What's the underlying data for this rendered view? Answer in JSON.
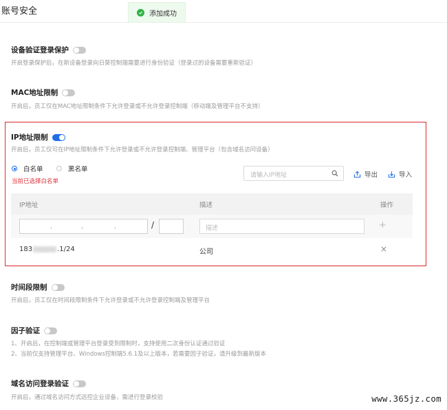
{
  "page": {
    "title": "账号安全"
  },
  "toast": {
    "text": "添加成功"
  },
  "sections": [
    {
      "title": "设备验证登录保护",
      "enabled": false,
      "desc": "开启登录保护后，在新设备登录向日葵控制端需要进行身份验证（登录过的设备需要重新验证）"
    },
    {
      "title": "MAC地址限制",
      "enabled": false,
      "desc": "开启后，员工仅在MAC地址限制条件下允许登录或不允许登录控制端（移动端及管理平台不支持）"
    },
    {
      "title": "IP地址限制",
      "enabled": true,
      "desc": "开启后，员工仅可在IP地址限制条件下允许登录或不允许登录控制端、管理平台（包含域名访问设备）"
    },
    {
      "title": "时间段限制",
      "enabled": false,
      "desc": "开启后，员工仅在时间段限制条件下允许登录或不允许登录控制端及管理平台"
    },
    {
      "title": "因子验证",
      "enabled": false,
      "desc_lines": [
        "1、开启后，在控制端或管理平台登录受到限制时，支持使用二次身份认证通过验证",
        "2、当前仅支持管理平台、Windows控制端5.6.1及以上版本，若需要因子验证，请升级到最新版本"
      ]
    },
    {
      "title": "域名访问登录验证",
      "enabled": false,
      "desc": "开启后，通过域名访问方式远控企业设备，需进行登录校验"
    }
  ],
  "ip": {
    "whitelist": "白名单",
    "blacklist": "黑名单",
    "selected": "whitelist",
    "hint": "当前已选择白名单",
    "search_placeholder": "请输入IP地址",
    "export": "导出",
    "import": "导入",
    "table": {
      "headers": {
        "ip": "IP地址",
        "desc": "描述",
        "action": "操作"
      },
      "input": {
        "dots": [
          ".",
          ".",
          "."
        ],
        "slash": "/",
        "desc_placeholder": "描述",
        "add": "+"
      },
      "rows": [
        {
          "ip_prefix": "183",
          "ip_suffix": ".1/24",
          "desc": "公司",
          "delete": "×"
        }
      ]
    }
  },
  "watermark": "www.365jz.com",
  "colors": {
    "accent": "#1f6fe8",
    "danger": "#d82a2a",
    "success": "#2fb344"
  }
}
